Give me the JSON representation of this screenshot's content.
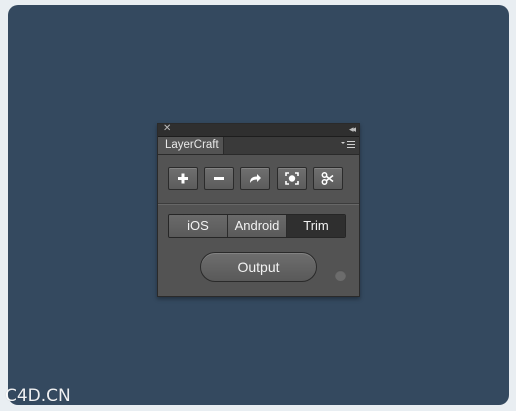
{
  "panel": {
    "close_glyph": "✕",
    "collapse_glyph": "◂◂",
    "tab_label": "LayerCraft",
    "menu_icon": "panel-menu-icon",
    "toolbar": [
      {
        "name": "add-button",
        "icon": "plus-icon"
      },
      {
        "name": "remove-button",
        "icon": "minus-icon"
      },
      {
        "name": "export-button",
        "icon": "share-arrow-icon"
      },
      {
        "name": "focus-button",
        "icon": "focus-frame-icon"
      },
      {
        "name": "cut-button",
        "icon": "scissors-icon"
      }
    ],
    "segments": [
      {
        "label": "iOS",
        "active": false
      },
      {
        "label": "Android",
        "active": false
      },
      {
        "label": "Trim",
        "active": true
      }
    ],
    "output_label": "Output"
  },
  "watermark": "C4D.CN",
  "colors": {
    "background": "#34495f",
    "panel": "#535353",
    "active_segment": "#2f2f2f"
  }
}
